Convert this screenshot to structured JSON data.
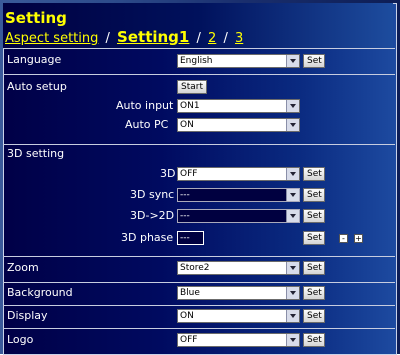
{
  "header": {
    "title": "Setting",
    "nav": {
      "link": "Aspect setting",
      "sep": "/",
      "current": "Setting1",
      "sep2": "/",
      "page2": "2",
      "sep3": "/",
      "page3": "3"
    }
  },
  "rows": {
    "language": {
      "label": "Language",
      "value": "English",
      "set": "Set"
    },
    "auto_setup": {
      "label": "Auto setup",
      "start": "Start"
    },
    "auto_input": {
      "label": "Auto input",
      "value": "ON1"
    },
    "auto_pc": {
      "label": "Auto PC",
      "value": "ON"
    },
    "setting_3d": {
      "label": "3D setting"
    },
    "d3": {
      "label": "3D",
      "value": "OFF",
      "set": "Set"
    },
    "d3_sync": {
      "label": "3D sync",
      "value": "---",
      "set": "Set"
    },
    "d3_2d": {
      "label": "3D->2D",
      "value": "---",
      "set": "Set"
    },
    "d3_phase": {
      "label": "3D phase",
      "value": "---",
      "set": "Set",
      "minus": "-",
      "plus": "+"
    },
    "zoom": {
      "label": "Zoom",
      "value": "Store2",
      "set": "Set"
    },
    "background": {
      "label": "Background",
      "value": "Blue",
      "set": "Set"
    },
    "display": {
      "label": "Display",
      "value": "ON",
      "set": "Set"
    },
    "logo": {
      "label": "Logo",
      "value": "OFF",
      "set": "Set"
    }
  },
  "colors": {
    "title": "#ffff00",
    "panel_dark": "#000047",
    "panel_light": "#1d4aa0"
  }
}
